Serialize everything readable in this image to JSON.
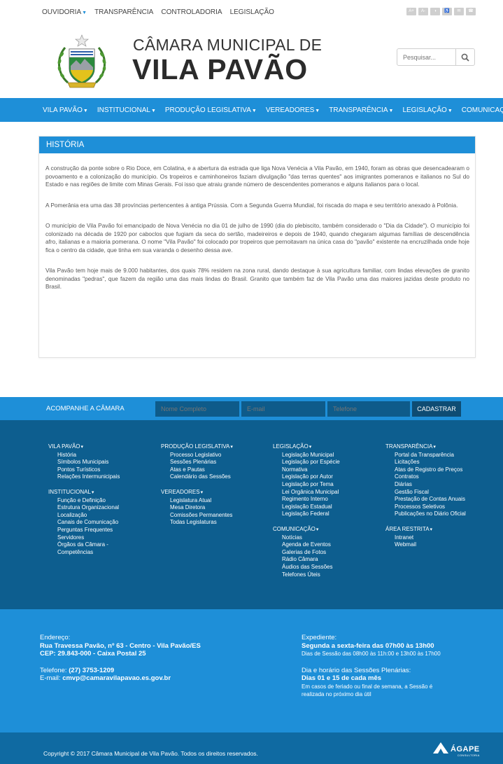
{
  "topbar": {
    "links": [
      "OUVIDORIA",
      "TRANSPARÊNCIA",
      "CONTROLADORIA",
      "LEGISLAÇÃO"
    ],
    "accessibility_icons": [
      "A+",
      "A-",
      "◑",
      "♿",
      "✉",
      "☎"
    ]
  },
  "header": {
    "title_small": "CÂMARA MUNICIPAL DE",
    "title_big": "VILA PAVÃO",
    "crest_text": "LEGISLATIVO VILA PAVÃO",
    "search_placeholder": "Pesquisar..."
  },
  "nav": {
    "items": [
      "VILA PAVÃO",
      "INSTITUCIONAL",
      "PRODUÇÃO LEGISLATIVA",
      "VEREADORES",
      "TRANSPARÊNCIA",
      "LEGISLAÇÃO",
      "COMUNICAÇÃO"
    ]
  },
  "article": {
    "title": "HISTÓRIA",
    "paragraphs": [
      "A construção da ponte sobre o Rio Doce, em Colatina, e a abertura da estrada que liga Nova Venécia a Vila Pavão, em 1940, foram as obras que desencadearam o povoamento e a colonização do município. Os tropeiros e caminhoneiros faziam divulgação \"das terras quentes\" aos imigrantes pomeranos e italianos no Sul do Estado e nas regiões de limite com Minas Gerais. Foi isso que atraiu grande número de descendentes pomeranos e alguns italianos para o local.",
      "A Pomerânia era uma das 38 províncias pertencentes à antiga Prússia. Com a Segunda Guerra Mundial, foi riscada do mapa e seu território anexado à Polônia.",
      "O município de Vila Pavão foi emancipado de Nova Venécia no dia 01 de julho de 1990 (dia do plebiscito, também considerado o \"Dia da Cidade\"). O município foi colonizado na década de 1920 por caboclos que fugiam da seca do sertão, madeireiros e depois de 1940, quando chegaram algumas famílias de descendência afro, italianas e a maioria pomerana. O nome \"Vila Pavão\" foi colocado por tropeiros que pernoitavam na única casa do \"pavão\" existente na encruzilhada onde hoje fica o centro da cidade, que tinha em sua varanda o desenho dessa ave.",
      "Vila Pavão tem hoje mais de 9.000 habitantes, dos quais 78% residem na zona rural, dando destaque à sua agricultura familiar, com lindas elevações de granito denominadas \"pedras\", que fazem da região uma das mais lindas do Brasil. Granito que também faz de Vila Pavão uma das maiores jazidas deste produto no Brasil."
    ]
  },
  "subscribe": {
    "label": "ACOMPANHE A CÂMARA",
    "name_placeholder": "Nome Completo",
    "email_placeholder": "E-mail",
    "phone_placeholder": "Telefone",
    "button": "CADASTRAR"
  },
  "footer_menu": {
    "col1": [
      {
        "title": "VILA PAVÃO",
        "items": [
          "História",
          "Símbolos Municipais",
          "Pontos Turísticos",
          "Relações Intermunicipais"
        ]
      },
      {
        "title": "INSTITUCIONAL",
        "items": [
          "Função e Definição",
          "Estrutura Organizacional",
          "Localização",
          "Canais de Comunicação",
          "Perguntas Frequentes",
          "Servidores",
          "Órgãos da Câmara -",
          "Competências"
        ]
      }
    ],
    "col2": [
      {
        "title": "PRODUÇÃO LEGISLATIVA",
        "items": [
          "Processo Legislativo",
          "Sessões Plenárias",
          "Atas e Pautas",
          "Calendário das Sessões"
        ]
      },
      {
        "title": "VEREADORES",
        "items": [
          "Legislatura Atual",
          "Mesa Diretora",
          "Comissões Permanentes",
          "Todas Legislaturas"
        ]
      }
    ],
    "col3": [
      {
        "title": "LEGISLAÇÃO",
        "items": [
          "Legislação Municipal",
          "Legislação por Espécie",
          "Normativa",
          "Legislação por Autor",
          "Legislação por Tema",
          "Lei Orgânica Municipal",
          "Regimento Interno",
          "Legislação Estadual",
          "Legislação Federal"
        ]
      },
      {
        "title": "COMUNICAÇÃO",
        "items": [
          "Notícias",
          "Agenda de Eventos",
          "Galerias de Fotos",
          "Rádio Câmara",
          "Áudios das Sessões",
          "Telefones Úteis"
        ]
      }
    ],
    "col4": [
      {
        "title": "TRANSPARÊNCIA",
        "items": [
          "Portal da Transparência",
          "Licitações",
          "Atas de Registro de Preços",
          "Contratos",
          "Diárias",
          "Gestão Fiscal",
          "Prestação de Contas Anuais",
          "Processos Seletivos",
          "Publicações no Diário Oficial"
        ]
      },
      {
        "title": "ÁREA RESTRITA",
        "items": [
          "Intranet",
          "Webmail"
        ]
      }
    ]
  },
  "contact": {
    "address_label": "Endereço:",
    "address_line1": "Rua Travessa Pavão, nº 63 - Centro - Vila Pavão/ES",
    "address_line2": "CEP: 29.843-000 - Caixa Postal 25",
    "phone_label": "Telefone:",
    "phone": "(27) 3753-1209",
    "email_label": "E-mail:",
    "email": "cmvp@camaravilapavao.es.gov.br",
    "hours_label": "Expediente:",
    "hours": "Segunda a sexta-feira das 07h00 às 13h00",
    "hours_note": "Dias de Sessão das 08h00 às 11h:00 e 13h00 às 17h00",
    "sessions_label": "Dia e horário das Sessões Plenárias:",
    "sessions": "Dias 01 e 15 de cada mês",
    "sessions_note1": "Em casos de feriado ou final de semana, a Sessão é",
    "sessions_note2": "realizada no próximo dia útil"
  },
  "copyright": {
    "text": "Copyright © 2017 Câmara Municipal de Vila Pavão. Todos os direitos reservados.",
    "brand": "ÁGAPE",
    "brand_sub": "CONSULTORIA"
  },
  "colors": {
    "primary": "#1e8fd8",
    "dark": "#0d5e8f",
    "copyright_bg": "#0f6aa2"
  }
}
